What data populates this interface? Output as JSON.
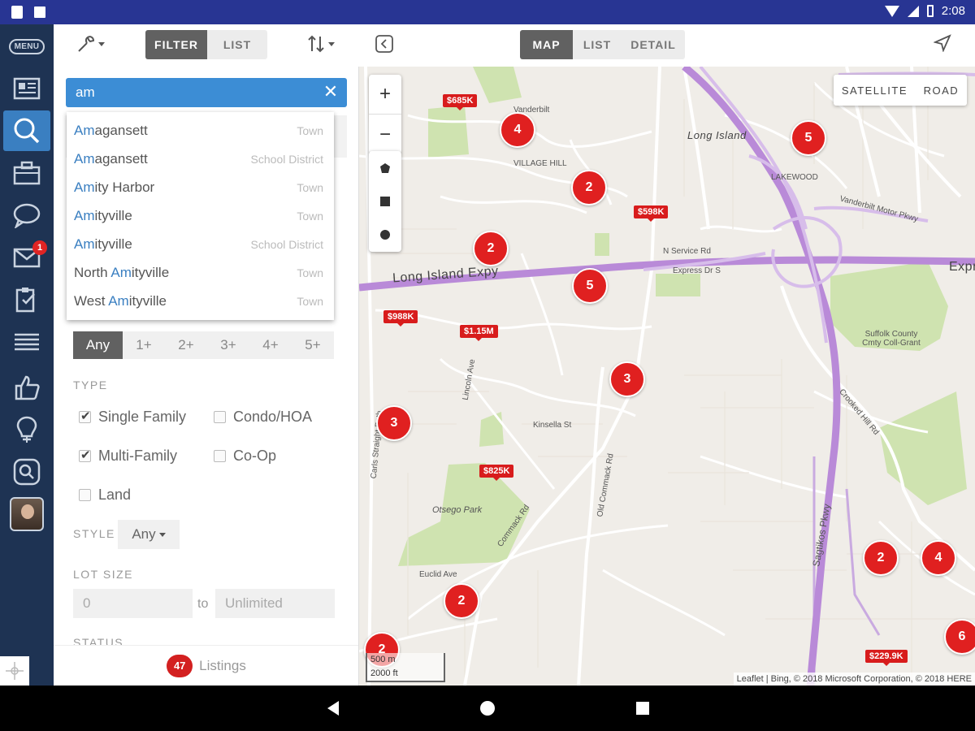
{
  "status_bar": {
    "time": "2:08"
  },
  "nav": {
    "menu_label": "MENU",
    "inbox_badge": "1"
  },
  "toolbar": {
    "filter_label": "FILTER",
    "list_label": "LIST",
    "map_label": "MAP",
    "map_list_label": "LIST",
    "detail_label": "DETAIL"
  },
  "search": {
    "value": "am",
    "suggestions": [
      {
        "pre": "",
        "hl": "Am",
        "post": "agansett",
        "kind": "Town"
      },
      {
        "pre": "",
        "hl": "Am",
        "post": "agansett",
        "kind": "School District"
      },
      {
        "pre": "",
        "hl": "Am",
        "post": "ity Harbor",
        "kind": "Town"
      },
      {
        "pre": "",
        "hl": "Am",
        "post": "ityville",
        "kind": "Town"
      },
      {
        "pre": "",
        "hl": "Am",
        "post": "ityville",
        "kind": "School District"
      },
      {
        "pre": "North ",
        "hl": "Am",
        "post": "ityville",
        "kind": "Town"
      },
      {
        "pre": "West ",
        "hl": "Am",
        "post": "ityville",
        "kind": "Town"
      }
    ]
  },
  "filters": {
    "beds": [
      "Any",
      "1+",
      "2+",
      "3+",
      "4+",
      "5+"
    ],
    "type_heading": "TYPE",
    "types": [
      {
        "label": "Single Family",
        "checked": true
      },
      {
        "label": "Condo/HOA",
        "checked": false
      },
      {
        "label": "Multi-Family",
        "checked": true
      },
      {
        "label": "Co-Op",
        "checked": false
      },
      {
        "label": "Land",
        "checked": false
      }
    ],
    "style_heading": "STYLE",
    "style_value": "Any",
    "lot_heading": "LOT SIZE",
    "lot_min_placeholder": "0",
    "lot_to": "to",
    "lot_max_placeholder": "Unlimited",
    "status_heading": "STATUS"
  },
  "footer": {
    "count": "47",
    "label": "Listings"
  },
  "map": {
    "satellite_label": "SATELLITE",
    "road_label": "ROAD",
    "zoom_in": "+",
    "zoom_out": "−",
    "clusters": [
      "4",
      "2",
      "5",
      "2",
      "5",
      "3",
      "3",
      "2",
      "2",
      "4",
      "6",
      "2"
    ],
    "prices": [
      "$685K",
      "$598K",
      "$988K",
      "$1.15M",
      "$825K",
      "$229.9K"
    ],
    "labels": {
      "expressway": "Long Island Expy",
      "expressway_east": "Expre",
      "hamlet": "Long Island",
      "park": "Otsego Park",
      "college": "Suffolk County Cmty Coll-Grant",
      "parkway": "Sagtikos Pkwy",
      "village_hill": "VILLAGE HILL",
      "vanderbilt": "Vanderbilt Motor Pkwy",
      "n_service": "N Service Rd",
      "express_dr": "Express Dr S",
      "commack": "Commack Rd",
      "old_commack": "Old Commack Rd",
      "crooked_hill": "Crooked Hill Rd",
      "carls_straight": "Carls Straight Path",
      "kinsella": "Kinsella St",
      "lincoln": "Lincoln Ave",
      "euclid": "Euclid Ave",
      "vanderbilt_ct": "Vanderbilt",
      "lakewood": "LAKEWOOD"
    },
    "scale_m": "500 m",
    "scale_ft": "2000 ft",
    "attribution": "Leaflet | Bing, © 2018 Microsoft Corporation, © 2018 HERE"
  },
  "colors": {
    "nav_bg": "#1e3353",
    "status_bg": "#283593",
    "search_bg": "#3c8dd5",
    "marker_red": "#e02020",
    "highway_purple": "#b98ad8"
  }
}
